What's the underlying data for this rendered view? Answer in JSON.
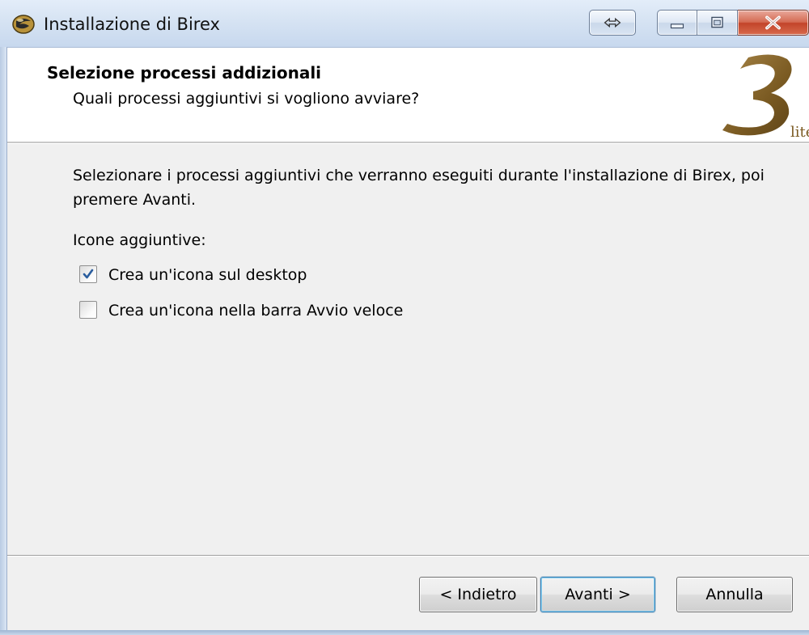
{
  "window": {
    "title": "Installazione di Birex"
  },
  "titlebar": {
    "icons": [
      "app-icon",
      "resize-icon",
      "minimize-icon",
      "maximize-icon",
      "close-icon"
    ],
    "close_color": "#c2442a"
  },
  "header": {
    "title": "Selezione processi addizionali",
    "subtitle": "Quali processi aggiuntivi si vogliono avviare?",
    "logo_text": "3",
    "logo_subtext": "lite",
    "logo_color": "#8a6d3b"
  },
  "body": {
    "intro": "Selezionare i processi aggiuntivi che verranno eseguiti durante l'installazione di Birex, poi premere Avanti.",
    "group_label": "Icone aggiuntive:",
    "options": [
      {
        "label": "Crea un'icona sul desktop",
        "checked": true
      },
      {
        "label": "Crea un'icona nella barra Avvio veloce",
        "checked": false
      }
    ]
  },
  "footer": {
    "back_label": "< Indietro",
    "next_label": "Avanti >",
    "cancel_label": "Annulla"
  },
  "colors": {
    "titlebar": "#d6e3f3",
    "body_bg": "#f0f0f0",
    "header_bg": "#ffffff",
    "default_button_border": "#3c7fb1"
  }
}
